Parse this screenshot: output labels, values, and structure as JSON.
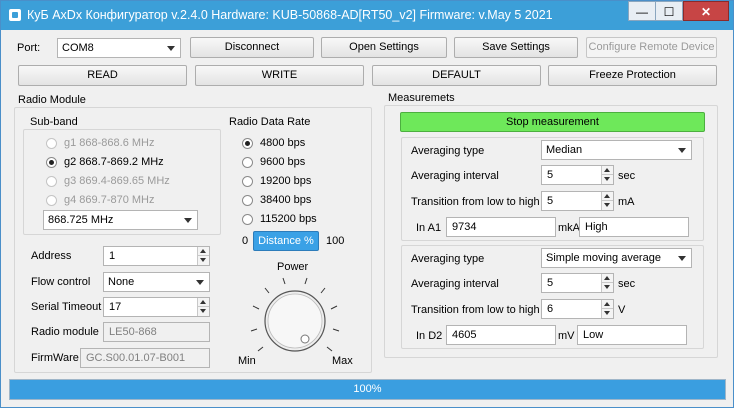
{
  "titlebar": {
    "title": "КуБ AxDx Конфигуратор v.2.4.0  Hardware: KUB-50868-AD[RT50_v2]  Firmware: v.May  5 2021",
    "minimize": "—",
    "maximize": "☐",
    "close": "✕"
  },
  "toolbar": {
    "port_label": "Port:",
    "port_value": "COM8",
    "disconnect": "Disconnect",
    "open_settings": "Open Settings",
    "save_settings": "Save Settings",
    "configure_remote": "Configure Remote Device",
    "read": "READ",
    "write": "WRITE",
    "default": "DEFAULT",
    "freeze": "Freeze Protection"
  },
  "radio_module": {
    "title": "Radio Module",
    "subband_title": "Sub-band",
    "subbands": [
      {
        "label": "g1 868-868.6 MHz",
        "checked": false,
        "disabled": true
      },
      {
        "label": "g2 868.7-869.2 MHz",
        "checked": true,
        "disabled": false
      },
      {
        "label": "g3 869.4-869.65 MHz",
        "checked": false,
        "disabled": true
      },
      {
        "label": "g4 869.7-870 MHz",
        "checked": false,
        "disabled": true
      }
    ],
    "frequency": "868.725 MHz",
    "rate_title": "Radio Data Rate",
    "rates": [
      {
        "label": "4800 bps",
        "checked": true
      },
      {
        "label": "9600 bps",
        "checked": false
      },
      {
        "label": "19200 bps",
        "checked": false
      },
      {
        "label": "38400 bps",
        "checked": false
      },
      {
        "label": "115200 bps",
        "checked": false
      }
    ],
    "distance_min": "0",
    "distance_label": "Distance %",
    "distance_max": "100",
    "address_label": "Address",
    "address_value": "1",
    "flow_label": "Flow control",
    "flow_value": "None",
    "serial_timeout_label": "Serial Timeout",
    "serial_timeout_value": "17",
    "radio_module_label": "Radio module",
    "radio_module_value": "LE50-868",
    "firmware_label": "FirmWare",
    "firmware_value": "GC.S00.01.07-B001",
    "power_label": "Power",
    "power_min": "Min",
    "power_max": "Max"
  },
  "measurements": {
    "title": "Measuremets",
    "stop_button": "Stop measurement",
    "stop_color": "#6ee85a",
    "block1": {
      "avg_type_label": "Averaging type",
      "avg_type_value": "Median",
      "avg_interval_label": "Averaging interval",
      "avg_interval_value": "5",
      "avg_interval_unit": "sec",
      "transition_label": "Transition from low to high",
      "transition_value": "5",
      "transition_unit": "mA",
      "input_label": "In A1",
      "input_value": "9734",
      "input_unit": "mkA",
      "input_state": "High"
    },
    "block2": {
      "avg_type_label": "Averaging type",
      "avg_type_value": "Simple moving average",
      "avg_interval_label": "Averaging interval",
      "avg_interval_value": "5",
      "avg_interval_unit": "sec",
      "transition_label": "Transition from low to high",
      "transition_value": "6",
      "transition_unit": "V",
      "input_label": "In D2",
      "input_value": "4605",
      "input_unit": "mV",
      "input_state": "Low"
    }
  },
  "progress": {
    "text": "100%",
    "value": 1.0,
    "color": "#3a9ee0"
  }
}
